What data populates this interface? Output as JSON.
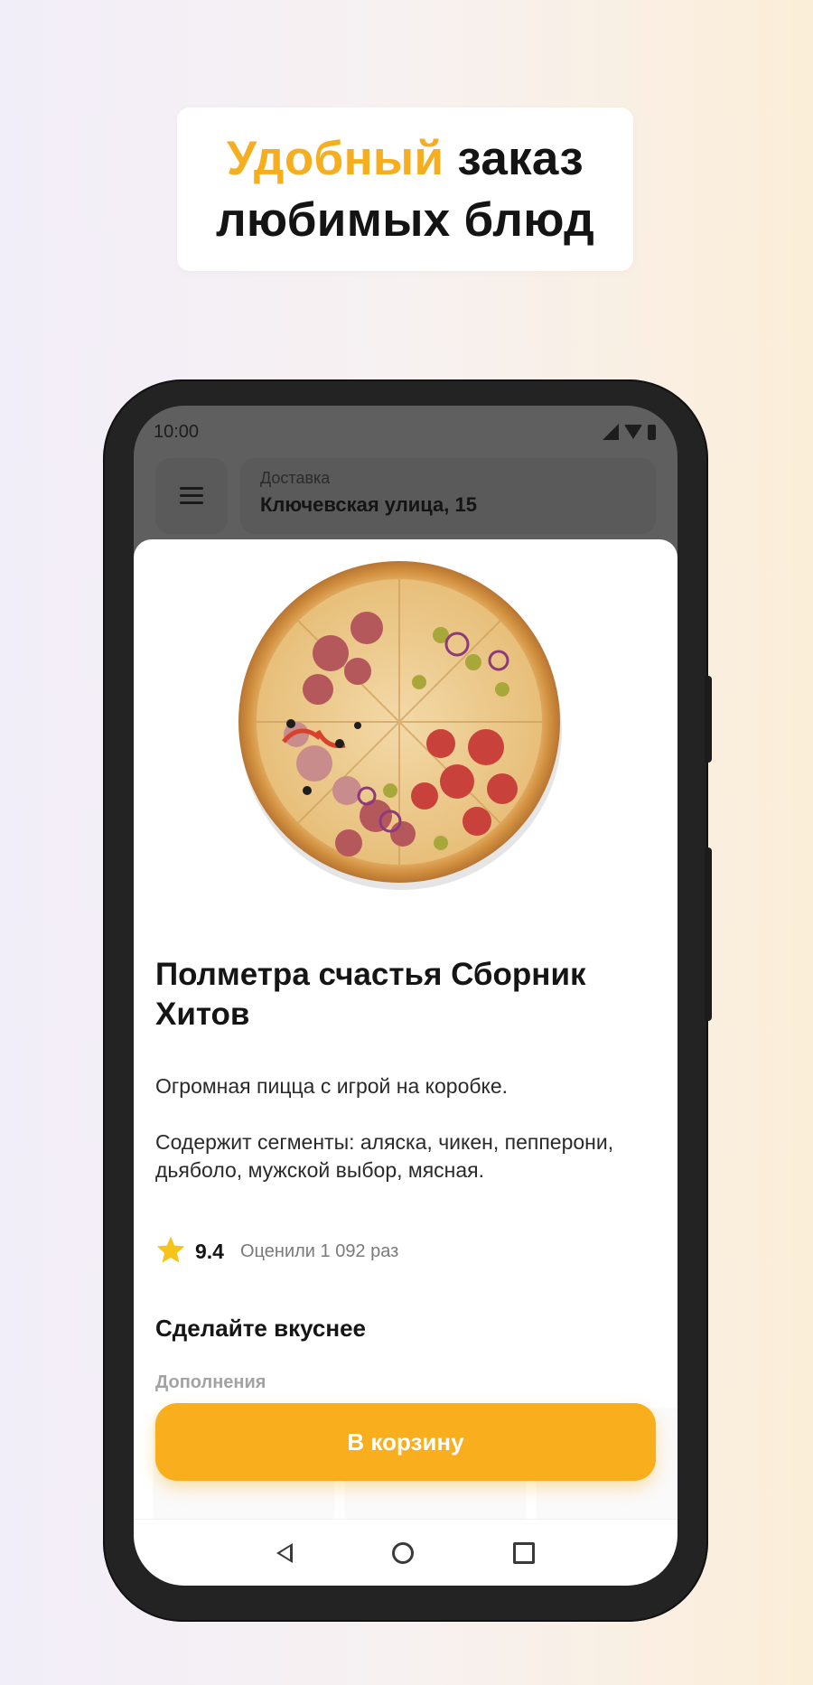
{
  "headline": {
    "accent": "Удобный",
    "rest_line1": "заказ",
    "line2": "любимых блюд"
  },
  "status_bar": {
    "time": "10:00"
  },
  "top_bar": {
    "address_label": "Доставка",
    "address_value": "Ключевская улица, 15"
  },
  "product": {
    "title": "Полметра счастья Сборник Хитов",
    "description": [
      "Огромная пицца с игрой на коробке.",
      "Содержит сегменты: аляска, чикен, пепперони, дьяболо, мужской выбор, мясная."
    ],
    "rating": "9.4",
    "rating_count": "Оценили 1 092 раз"
  },
  "extras": {
    "title": "Сделайте вкуснее",
    "subtitle": "Дополнения"
  },
  "cart_button": {
    "label": "В корзину"
  },
  "colors": {
    "accent": "#f9ae1e",
    "headline_accent": "#f5ae1f",
    "star": "#f6c31a"
  },
  "icons": [
    "menu-icon",
    "signal-icon",
    "wifi-icon",
    "battery-icon",
    "star-icon",
    "nav-back-icon",
    "nav-home-icon",
    "nav-recent-icon"
  ]
}
